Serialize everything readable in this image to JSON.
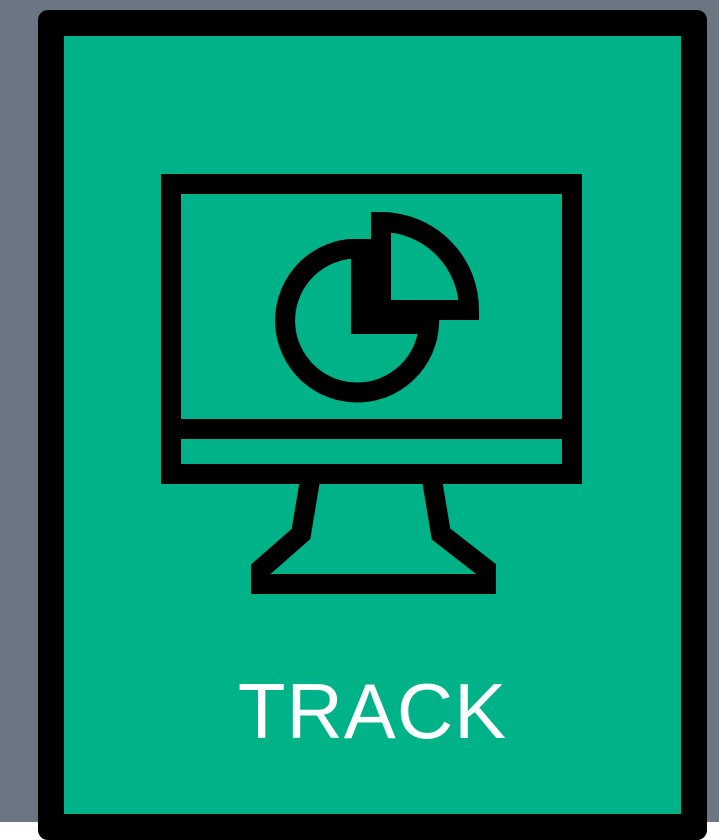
{
  "colors": {
    "background": "#6a7782",
    "tile_fill": "#00b287",
    "tile_border": "#000000",
    "icon_stroke": "#000000",
    "label_text": "#ffffff"
  },
  "tile": {
    "icon": "monitor-pie-chart-icon",
    "label": "TRACK"
  }
}
